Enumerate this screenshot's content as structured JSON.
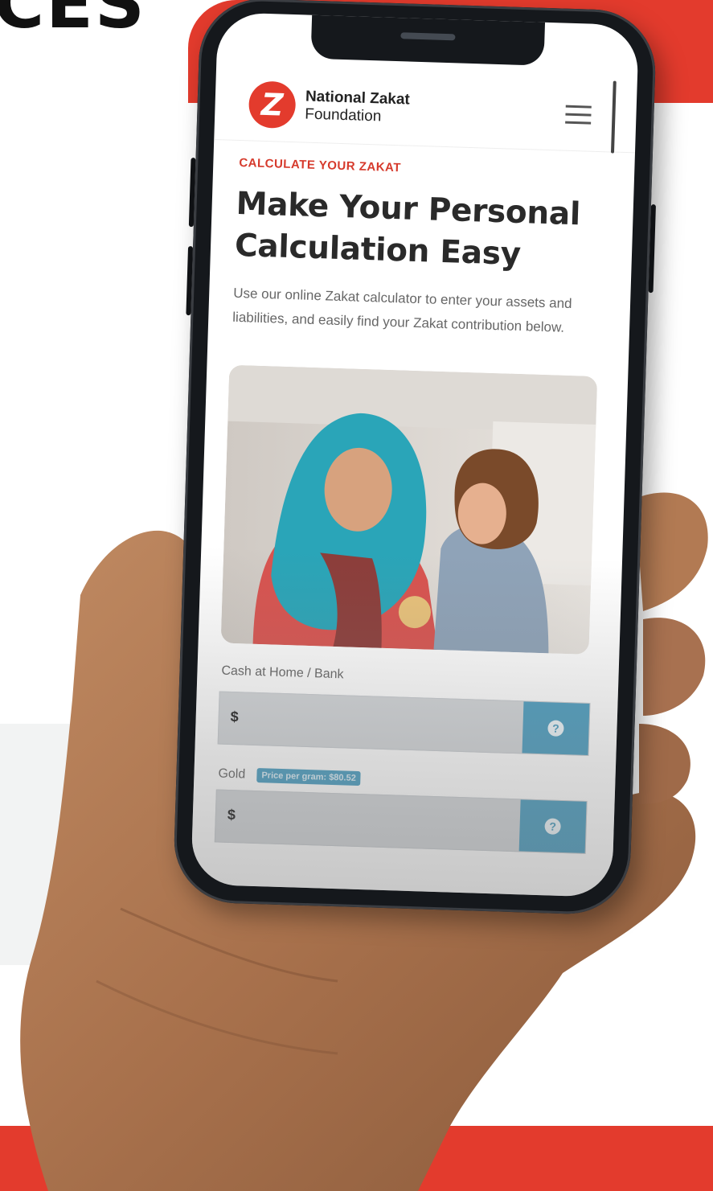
{
  "backdrop": {
    "heading_fragment": "CES",
    "accent_color": "#e33b2d"
  },
  "site": {
    "logo_letter": "Z",
    "logo_name": "National Zakat",
    "logo_sub": "Foundation",
    "menu_icon": "hamburger-menu-icon"
  },
  "hero": {
    "eyebrow": "CALCULATE YOUR ZAKAT",
    "title": "Make Your Personal Calculation Easy",
    "intro": "Use our online Zakat calculator to enter your assets and liabilities, and easily find your Zakat contribution below."
  },
  "form": {
    "cash": {
      "label": "Cash at Home / Bank",
      "currency": "$",
      "value": "",
      "help_icon": "question-circle-icon"
    },
    "gold": {
      "label": "Gold",
      "price_badge": "Price per gram: $80.52",
      "currency": "$",
      "value": "",
      "help_icon": "question-circle-icon"
    }
  },
  "colors": {
    "brand_red": "#e33b2d",
    "button_blue": "#4d9ec0",
    "title_text": "#2a2a2a"
  }
}
